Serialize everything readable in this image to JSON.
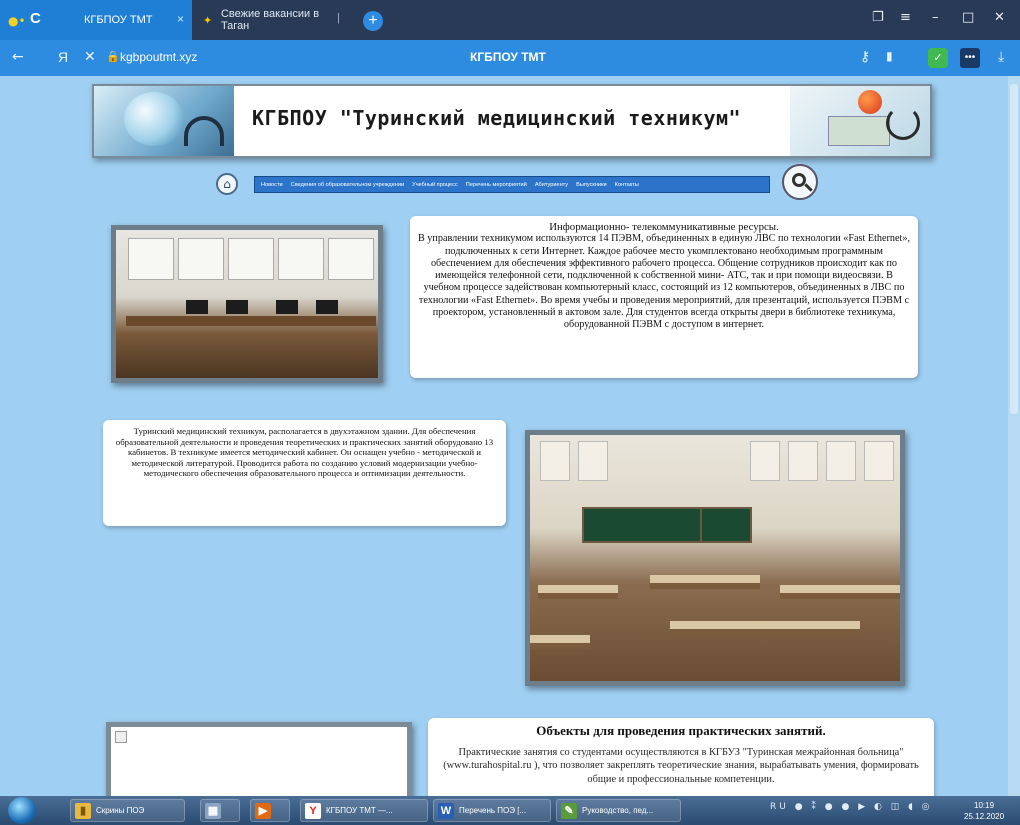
{
  "browser": {
    "tab1_title": "КГБПОУ ТМТ",
    "tab2_title": "Свежие вакансии в Таган",
    "url": "kgbpoutmt.xyz",
    "page_title": "КГБПОУ ТМТ"
  },
  "site": {
    "title": "КГБПОУ \"Туринский медицинский техникум\"",
    "nav": [
      "Новости",
      "Сведения об образовательном учреждении",
      "Учебный процесс",
      "Перечень мероприятий",
      "Абитуриенту",
      "Выпускники",
      "Контакты"
    ]
  },
  "section1": {
    "heading": "Информационно- телекоммуникативные ресурсы.",
    "body": "В управлении техникумом используются 14 ПЭВМ, объединенных в единую ЛВС по технологии «Fast Ethernet», подключенных к сети Интернет. Каждое рабочее место укомплектовано необходимым программным обеспечением для обеспечения эффективного рабочего процесса. Общение сотрудников происходит как по имеющейся телефонной сети, подключенной к собственной мини- АТС, так и при помощи видеосвязи. В учебном процессе задействован компьютерный класс, состоящий из 12 компьютеров, объединенных в ЛВС по технологии «Fast Ethernet». Во время учебы и проведения мероприятий, для презентаций, используется ПЭВМ с проектором, установленный в актовом зале. Для студентов всегда открыты двери в библиотеке техникума, оборудованной ПЭВМ с доступом в интернет."
  },
  "section2": {
    "body": "Туринский медицинский техникум, располагается в двухэтажном здании. Для обеспечения образовательной деятельности и проведения теоретических и практических занятий оборудовано 13 кабинетов. В техникуме имеется методический кабинет. Он оснащен учебно - методической и методической литературой. Проводится работа по созданию условий модернизации учебно-методического обеспечения образовательного процесса и оптимизации деятельности."
  },
  "section3": {
    "heading": "Объекты для проведения практических занятий.",
    "body": "Практические занятия со студентами осуществляются в КГБУЗ \"Туринская межрайонная больница\" (www.turahospital.ru ), что позволяет закреплять теоретические знания, вырабатывать умения, формировать общие и профессиональные компетенции."
  },
  "taskbar": {
    "items": [
      "Скрины ПОЭ",
      "КГБПОУ ТМТ —...",
      "Перечень ПОЭ [...",
      "Руководство, пед..."
    ],
    "lang": "RU",
    "time": "10:19",
    "date": "25.12.2020"
  }
}
